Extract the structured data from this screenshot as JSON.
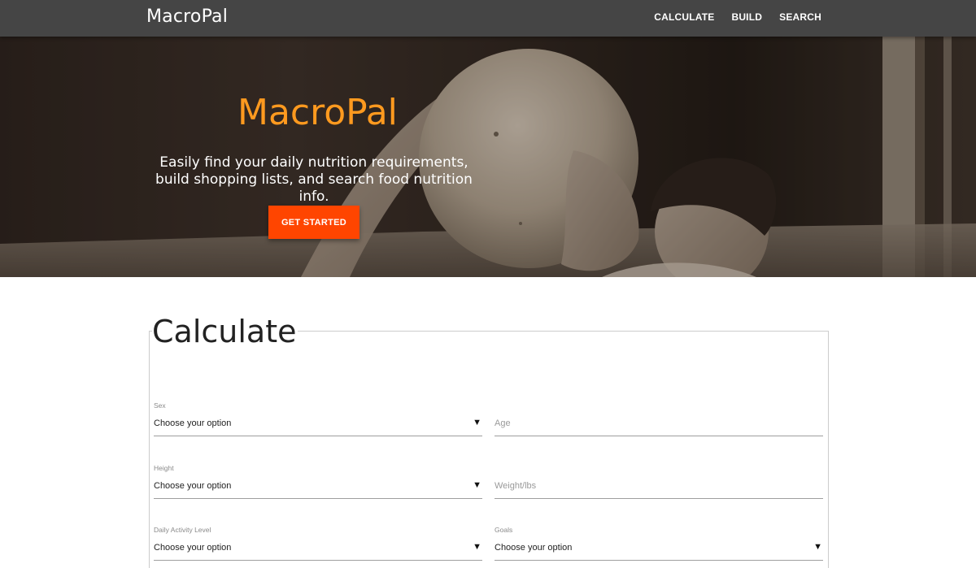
{
  "nav": {
    "brand": "MacroPal",
    "links": [
      "CALCULATE",
      "BUILD",
      "SEARCH"
    ]
  },
  "hero": {
    "title": "MacroPal",
    "subtitle": "Easily find your daily nutrition requirements, build shopping lists, and search food nutrition info.",
    "cta_label": "GET STARTED"
  },
  "calculate": {
    "title": "Calculate",
    "fields": {
      "sex": {
        "label": "Sex",
        "value": "Choose your option"
      },
      "age": {
        "placeholder": "Age"
      },
      "height": {
        "label": "Height",
        "value": "Choose your option"
      },
      "weight": {
        "placeholder": "Weight/lbs"
      },
      "activity": {
        "label": "Daily Activity Level",
        "value": "Choose your option"
      },
      "goals": {
        "label": "Goals",
        "value": "Choose your option"
      }
    }
  },
  "colors": {
    "nav_bg": "#454545",
    "accent_orange": "#ff9a1f",
    "cta_bg": "#ff4500"
  },
  "icons": {
    "caret": "▼"
  }
}
